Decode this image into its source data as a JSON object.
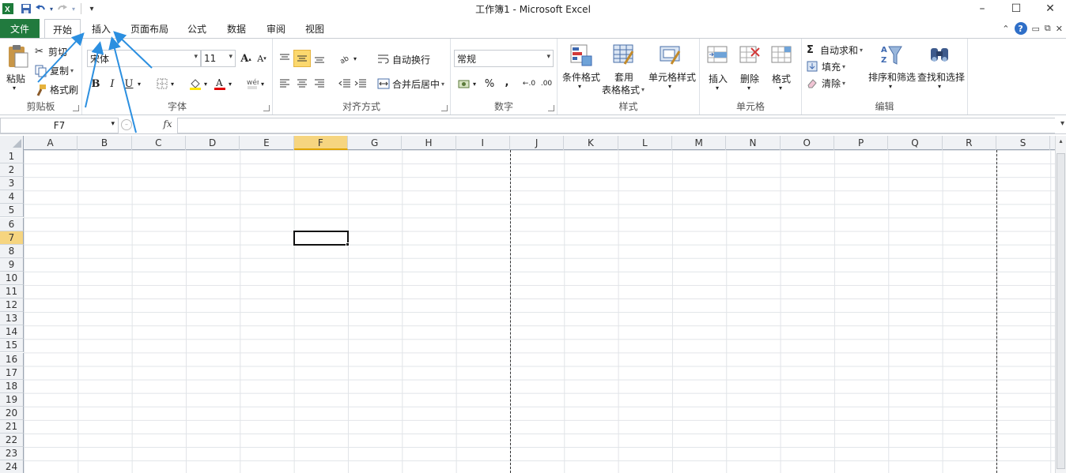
{
  "window": {
    "title": "工作簿1 - Microsoft Excel",
    "controls": {
      "minimize": "–",
      "maximize": "☐",
      "close": "✕"
    }
  },
  "quick_access": {
    "customize": "▾"
  },
  "tabs": {
    "file": "文件",
    "items": [
      "开始",
      "插入",
      "页面布局",
      "公式",
      "数据",
      "审阅",
      "视图"
    ],
    "active": "开始"
  },
  "ribbon": {
    "clipboard": {
      "label": "剪贴板",
      "paste": "粘贴",
      "cut": "剪切",
      "copy": "复制",
      "format_painter": "格式刷"
    },
    "font": {
      "label": "字体",
      "font_name": "宋体",
      "font_size": "11",
      "bold": "B",
      "italic": "I",
      "underline": "U",
      "grow": "A",
      "shrink": "A"
    },
    "alignment": {
      "label": "对齐方式",
      "wrap_text": "自动换行",
      "merge_center": "合并后居中"
    },
    "number": {
      "label": "数字",
      "format": "常规",
      "percent": "%",
      "comma": ","
    },
    "styles": {
      "label": "样式",
      "conditional": "条件格式",
      "table_line1": "套用",
      "table_line2": "表格格式",
      "cell_styles": "单元格样式"
    },
    "cells": {
      "label": "单元格",
      "insert": "插入",
      "delete": "删除",
      "format": "格式"
    },
    "editing": {
      "label": "编辑",
      "autosum": "自动求和",
      "fill": "填充",
      "clear": "清除",
      "sort_filter": "排序和筛选",
      "find_select": "查找和选择"
    }
  },
  "formula_bar": {
    "name_box": "F7",
    "fx": "fx",
    "value": ""
  },
  "sheet": {
    "columns": [
      "A",
      "B",
      "C",
      "D",
      "E",
      "F",
      "G",
      "H",
      "I",
      "J",
      "K",
      "L",
      "M",
      "N",
      "O",
      "P",
      "Q",
      "R",
      "S"
    ],
    "rows": [
      "1",
      "2",
      "3",
      "4",
      "5",
      "6",
      "7",
      "8",
      "9",
      "10",
      "11",
      "12",
      "13",
      "14",
      "15",
      "16",
      "17",
      "18",
      "19",
      "20",
      "21",
      "22",
      "23",
      "24"
    ],
    "active_cell": "F7",
    "active_column": "F",
    "active_row": "7"
  },
  "colors": {
    "file_tab": "#217a3e",
    "selection_highlight": "#f6d580",
    "annotation_arrows": "#2b8fe0"
  }
}
